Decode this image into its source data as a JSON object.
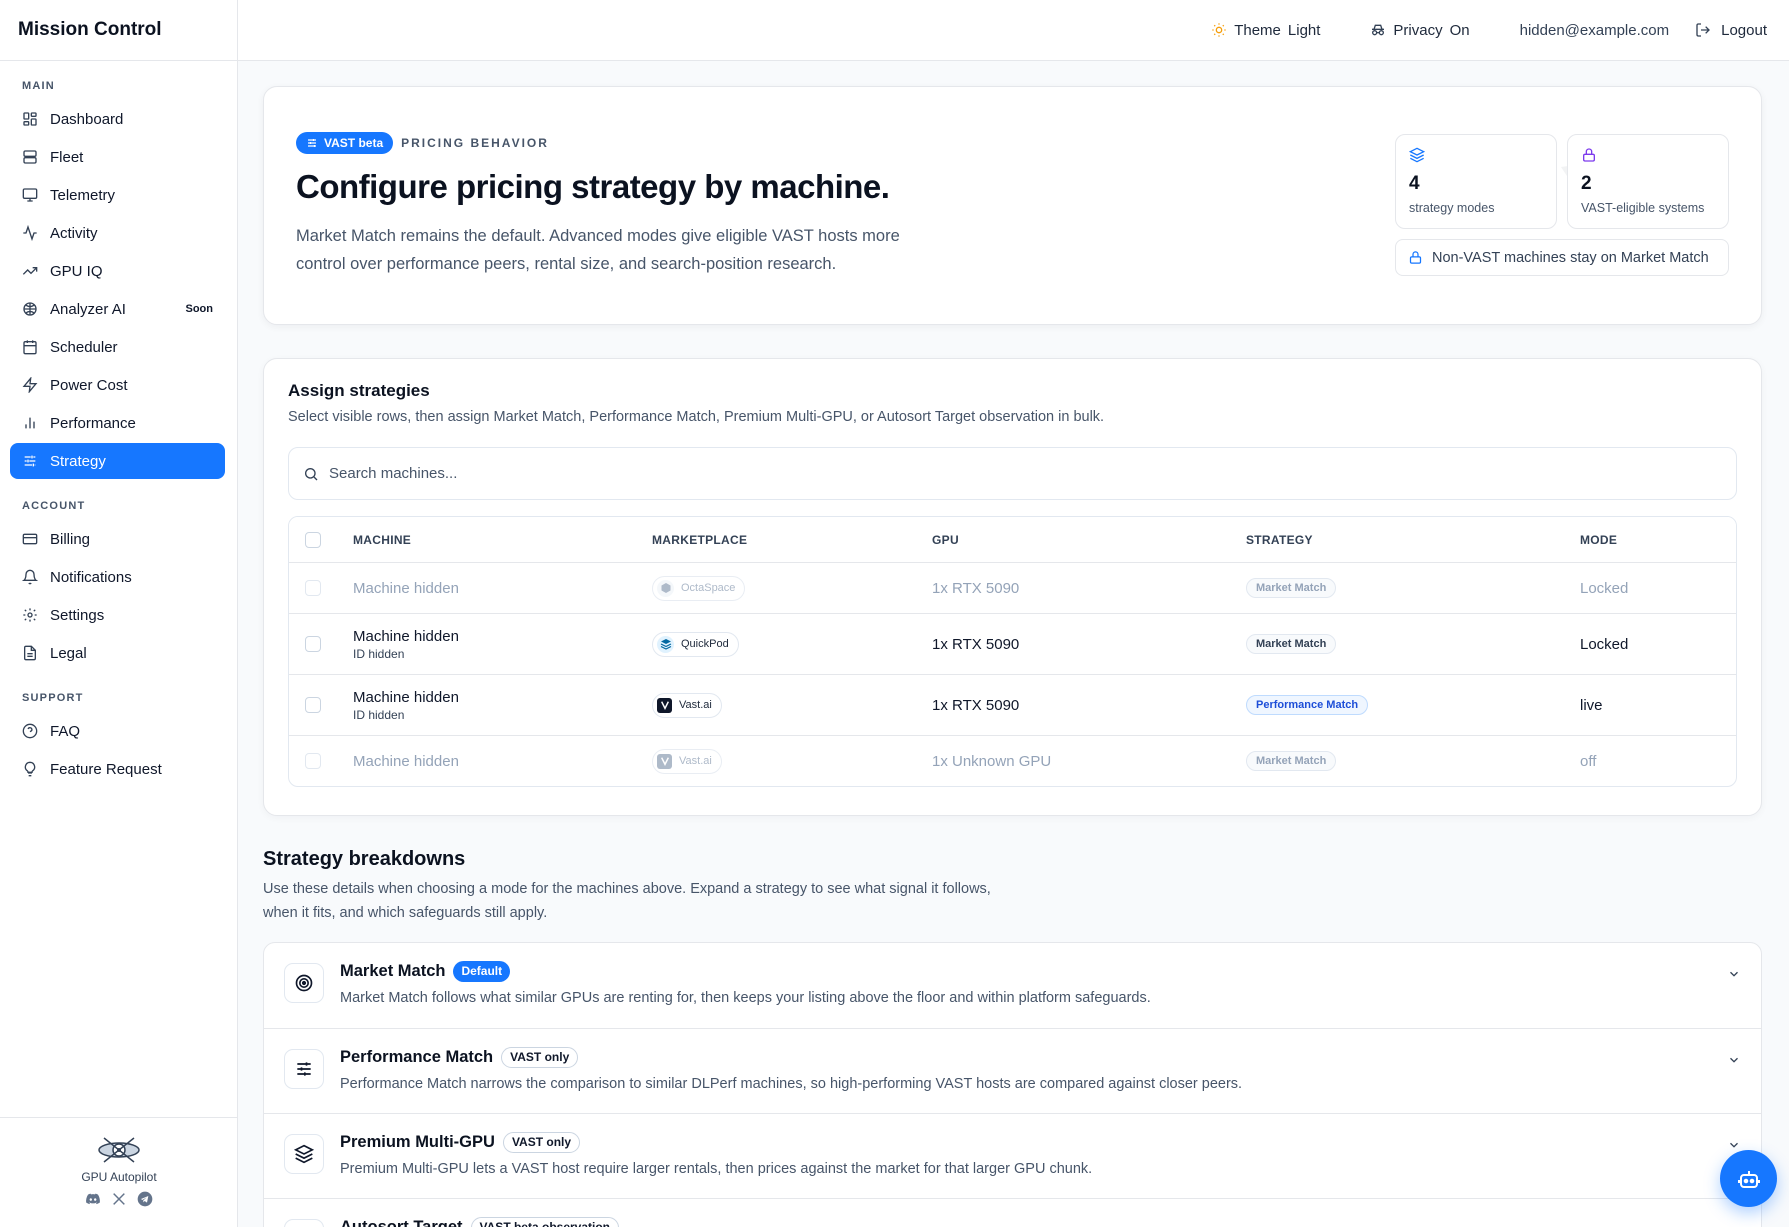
{
  "app": {
    "title": "Mission Control",
    "footer_name": "GPU Autopilot"
  },
  "sidebar": {
    "sections": [
      {
        "label": "MAIN",
        "items": [
          {
            "label": "Dashboard",
            "icon": "dashboard-icon"
          },
          {
            "label": "Fleet",
            "icon": "server-icon"
          },
          {
            "label": "Telemetry",
            "icon": "monitor-icon"
          },
          {
            "label": "Activity",
            "icon": "activity-icon"
          },
          {
            "label": "GPU IQ",
            "icon": "trending-icon"
          },
          {
            "label": "Analyzer AI",
            "icon": "brain-icon",
            "badge": "Soon"
          },
          {
            "label": "Scheduler",
            "icon": "calendar-icon"
          },
          {
            "label": "Power Cost",
            "icon": "zap-icon"
          },
          {
            "label": "Performance",
            "icon": "bar-chart-icon"
          },
          {
            "label": "Strategy",
            "icon": "sliders-icon",
            "active": true
          }
        ]
      },
      {
        "label": "ACCOUNT",
        "items": [
          {
            "label": "Billing",
            "icon": "credit-card-icon"
          },
          {
            "label": "Notifications",
            "icon": "bell-icon"
          },
          {
            "label": "Settings",
            "icon": "gear-icon"
          },
          {
            "label": "Legal",
            "icon": "document-icon"
          }
        ]
      },
      {
        "label": "SUPPORT",
        "items": [
          {
            "label": "FAQ",
            "icon": "help-icon"
          },
          {
            "label": "Feature Request",
            "icon": "lightbulb-icon"
          }
        ]
      }
    ]
  },
  "topbar": {
    "theme_label": "Theme",
    "theme_value": "Light",
    "privacy_label": "Privacy",
    "privacy_value": "On",
    "email": "hidden@example.com",
    "logout": "Logout"
  },
  "hero": {
    "badge": "VAST beta",
    "eyebrow": "PRICING BEHAVIOR",
    "title": "Configure pricing strategy by machine.",
    "description": "Market Match remains the default. Advanced modes give eligible VAST hosts more control over performance peers, rental size, and search-position research.",
    "stats": [
      {
        "value": "4",
        "label": "strategy modes",
        "icon": "layers-icon",
        "color": "#1677ff"
      },
      {
        "value": "2",
        "label": "VAST-eligible systems",
        "icon": "lock-icon",
        "color": "#7c3aed"
      }
    ],
    "notice": "Non-VAST machines stay on Market Match"
  },
  "assign": {
    "title": "Assign strategies",
    "subtitle": "Select visible rows, then assign Market Match, Performance Match, Premium Multi-GPU, or Autosort Target observation in bulk.",
    "search_placeholder": "Search machines...",
    "columns": {
      "machine": "MACHINE",
      "marketplace": "MARKETPLACE",
      "gpu": "GPU",
      "strategy": "STRATEGY",
      "mode": "MODE"
    },
    "rows": [
      {
        "machine": "Machine hidden",
        "id": "",
        "marketplace": "OctaSpace",
        "gpu": "1x RTX 5090",
        "strategy": "Market Match",
        "mode": "Locked",
        "dim": true
      },
      {
        "machine": "Machine hidden",
        "id": "ID hidden",
        "marketplace": "QuickPod",
        "gpu": "1x RTX 5090",
        "strategy": "Market Match",
        "mode": "Locked",
        "dim": false
      },
      {
        "machine": "Machine hidden",
        "id": "ID hidden",
        "marketplace": "Vast.ai",
        "gpu": "1x RTX 5090",
        "strategy": "Performance Match",
        "mode": "live",
        "dim": false
      },
      {
        "machine": "Machine hidden",
        "id": "",
        "marketplace": "Vast.ai",
        "gpu": "1x Unknown GPU",
        "strategy": "Market Match",
        "mode": "off",
        "dim": true
      }
    ]
  },
  "breakdowns": {
    "title": "Strategy breakdowns",
    "description": "Use these details when choosing a mode for the machines above. Expand a strategy to see what signal it follows, when it fits, and which safeguards still apply.",
    "items": [
      {
        "title": "Market Match",
        "tag": "Default",
        "tag_style": "filled",
        "icon": "target-icon",
        "text": "Market Match follows what similar GPUs are renting for, then keeps your listing above the floor and within platform safeguards."
      },
      {
        "title": "Performance Match",
        "tag": "VAST only",
        "tag_style": "outline",
        "icon": "sliders-icon",
        "text": "Performance Match narrows the comparison to similar DLPerf machines, so high-performing VAST hosts are compared against closer peers."
      },
      {
        "title": "Premium Multi-GPU",
        "tag": "VAST only",
        "tag_style": "outline",
        "icon": "layers-icon",
        "text": "Premium Multi-GPU lets a VAST host require larger rentals, then prices against the market for that larger GPU chunk."
      },
      {
        "title": "Autosort Target",
        "tag": "VAST beta observation",
        "tag_style": "outline",
        "icon": "target-icon",
        "text": ""
      }
    ]
  },
  "colors": {
    "accent": "#1677ff",
    "text": "#0f172a",
    "muted": "#475569",
    "border": "#e5e7eb"
  }
}
